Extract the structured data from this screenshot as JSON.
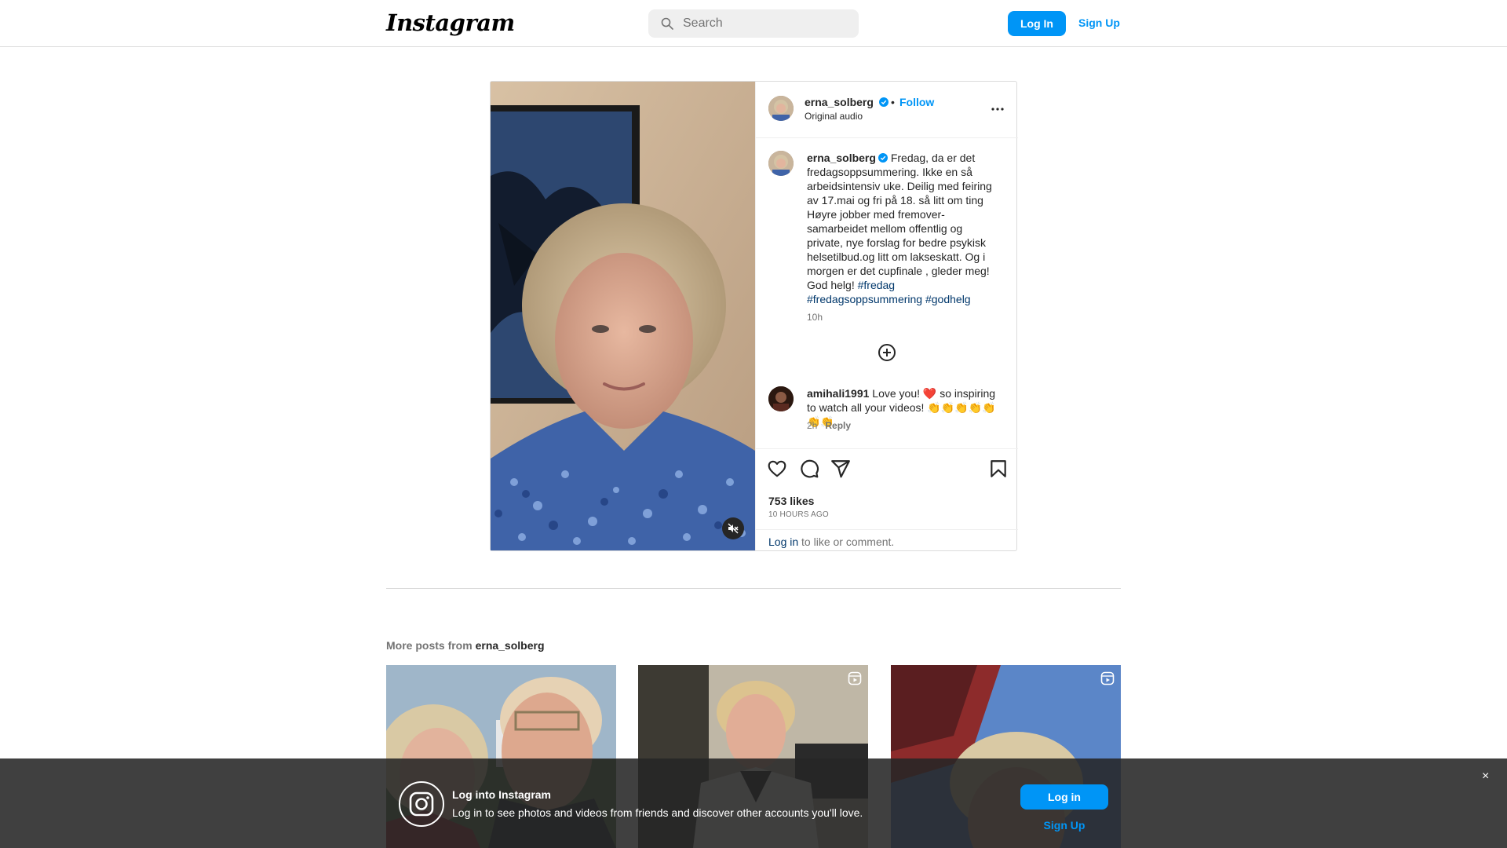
{
  "header": {
    "logo": "Instagram",
    "search_placeholder": "Search",
    "login_label": "Log In",
    "signup_label": "Sign Up"
  },
  "post": {
    "username": "erna_solberg",
    "separator": "•",
    "follow_label": "Follow",
    "audio": "Original audio",
    "more_label": "...",
    "caption_text": "Fredag, da er det fredagsoppsummering. Ikke en så arbeidsintensiv uke. Deilig med feiring av 17.mai og fri på 18. så litt om ting Høyre jobber med fremover- samarbeidet mellom offentlig og private, nye forslag for bedre psykisk helsetilbud.og litt om lakseskatt. Og i morgen er det cupfinale , gleder meg! God helg! ",
    "hashtags": [
      "#fredag",
      "#fredagsoppsummering",
      "#godhelg"
    ],
    "caption_time": "10h",
    "comments": [
      {
        "username": "amihali1991",
        "text": "Love you! ❤️ so inspiring to watch all your videos! 👏👏👏👏👏👏👏",
        "time": "2h",
        "reply_label": "Reply"
      }
    ],
    "likes": "753 likes",
    "time_ago": "10 HOURS AGO",
    "login_link": "Log in",
    "login_suffix": " to like or comment."
  },
  "more_posts": {
    "prefix": "More posts from ",
    "username": "erna_solberg"
  },
  "login_banner": {
    "title": "Log into Instagram",
    "text": "Log in to see photos and videos from friends and discover other accounts you'll love.",
    "login_label": "Log in",
    "signup_label": "Sign Up",
    "close_label": "×"
  },
  "colors": {
    "accent": "#0095f6",
    "link_dark": "#00376b",
    "verified": "#0095f6"
  },
  "icons": [
    "search-icon",
    "verified-icon",
    "more-icon",
    "add-circle-icon",
    "heart-icon",
    "comment-icon",
    "share-icon",
    "bookmark-icon",
    "mute-icon",
    "reel-icon",
    "instagram-icon",
    "close-icon"
  ]
}
